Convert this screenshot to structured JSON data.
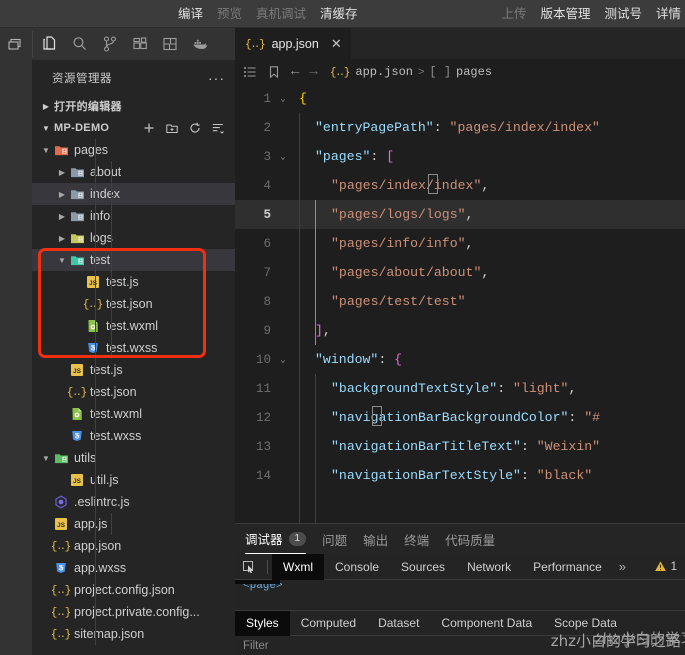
{
  "topbar": {
    "left_items": [
      {
        "label": "编译",
        "dim": false
      },
      {
        "label": "预览",
        "dim": true
      },
      {
        "label": "真机调试",
        "dim": true
      },
      {
        "label": "清缓存",
        "dim": false
      }
    ],
    "right_items": [
      {
        "label": "上传",
        "dim": true
      },
      {
        "label": "版本管理",
        "dim": false
      },
      {
        "label": "测试号",
        "dim": false
      },
      {
        "label": "详情",
        "dim": false
      }
    ]
  },
  "activity_bar": {
    "icons": [
      "layout-panel-icon",
      "files-explorer-icon",
      "search-icon",
      "source-control-icon",
      "extensions-icon",
      "split-layout-icon",
      "docker-icon"
    ]
  },
  "sidebar": {
    "title": "资源管理器",
    "more_actions": "···",
    "open_editors_label": "打开的编辑器",
    "project_label": "MP-DEMO",
    "project_actions": [
      "new-file-icon",
      "new-folder-icon",
      "refresh-icon",
      "collapse-all-icon"
    ],
    "tree": [
      {
        "label": "pages",
        "depth": 1,
        "type": "folder",
        "color": "#e06c4a",
        "open": true,
        "selected": false
      },
      {
        "label": "about",
        "depth": 2,
        "type": "folder",
        "color": "#8a9aa8",
        "open": false,
        "selected": false
      },
      {
        "label": "index",
        "depth": 2,
        "type": "folder",
        "color": "#8a9aa8",
        "open": false,
        "selected": true
      },
      {
        "label": "info",
        "depth": 2,
        "type": "folder",
        "color": "#8a9aa8",
        "open": false,
        "selected": false
      },
      {
        "label": "logs",
        "depth": 2,
        "type": "folder",
        "color": "#c3c95a",
        "open": false,
        "selected": false
      },
      {
        "label": "test",
        "depth": 2,
        "type": "folder",
        "color": "#3fc7a8",
        "open": true,
        "selected": true
      },
      {
        "label": "test.js",
        "depth": 3,
        "type": "js",
        "selected": false
      },
      {
        "label": "test.json",
        "depth": 3,
        "type": "json",
        "selected": false
      },
      {
        "label": "test.wxml",
        "depth": 3,
        "type": "wxml",
        "selected": false
      },
      {
        "label": "test.wxss",
        "depth": 3,
        "type": "wxss",
        "selected": false
      },
      {
        "label": "test.js",
        "depth": 2,
        "type": "js",
        "selected": false
      },
      {
        "label": "test.json",
        "depth": 2,
        "type": "json",
        "selected": false
      },
      {
        "label": "test.wxml",
        "depth": 2,
        "type": "wxml",
        "selected": false
      },
      {
        "label": "test.wxss",
        "depth": 2,
        "type": "wxss",
        "selected": false
      },
      {
        "label": "utils",
        "depth": 1,
        "type": "folder",
        "color": "#5dbb63",
        "open": true,
        "selected": false
      },
      {
        "label": "util.js",
        "depth": 2,
        "type": "js",
        "selected": false
      },
      {
        "label": ".eslintrc.js",
        "depth": 1,
        "type": "eslint",
        "selected": false
      },
      {
        "label": "app.js",
        "depth": 1,
        "type": "js",
        "selected": false
      },
      {
        "label": "app.json",
        "depth": 1,
        "type": "json",
        "selected": false
      },
      {
        "label": "app.wxss",
        "depth": 1,
        "type": "wxss",
        "selected": false
      },
      {
        "label": "project.config.json",
        "depth": 1,
        "type": "json",
        "selected": false
      },
      {
        "label": "project.private.config...",
        "depth": 1,
        "type": "json",
        "selected": false
      },
      {
        "label": "sitemap.json",
        "depth": 1,
        "type": "json",
        "selected": false
      }
    ],
    "annotation_color": "#f03010"
  },
  "editor": {
    "tab": {
      "label": "app.json",
      "icon": "json-icon",
      "close": "✕"
    },
    "breadcrumb": {
      "icons": [
        "outline-list-icon",
        "bookmark-icon",
        "back-arrow-icon",
        "forward-arrow-icon"
      ],
      "back": "←",
      "forward": "→",
      "file": "app.json",
      "separator": ">",
      "node_bracket": "[ ]",
      "node": "pages"
    },
    "active_line": 5,
    "lines": [
      {
        "n": 1,
        "fold": "v",
        "indent": 0,
        "tokens": [
          {
            "t": "{",
            "c": "br"
          }
        ]
      },
      {
        "n": 2,
        "fold": "",
        "indent": 1,
        "tokens": [
          {
            "t": "\"entryPagePath\"",
            "c": "k"
          },
          {
            "t": ": ",
            "c": "p"
          },
          {
            "t": "\"pages/index/index\"",
            "c": "s"
          }
        ]
      },
      {
        "n": 3,
        "fold": "v",
        "indent": 1,
        "tokens": [
          {
            "t": "\"pages\"",
            "c": "k"
          },
          {
            "t": ": ",
            "c": "p"
          },
          {
            "t": "[",
            "c": "brp"
          }
        ]
      },
      {
        "n": 4,
        "fold": "",
        "indent": 2,
        "tokens": [
          {
            "t": "\"pages/index/index\"",
            "c": "s"
          },
          {
            "t": ",",
            "c": "p"
          }
        ]
      },
      {
        "n": 5,
        "fold": "",
        "indent": 2,
        "tokens": [
          {
            "t": "\"pages/logs/logs\"",
            "c": "s"
          },
          {
            "t": ",",
            "c": "p"
          }
        ]
      },
      {
        "n": 6,
        "fold": "",
        "indent": 2,
        "tokens": [
          {
            "t": "\"pages/info/info\"",
            "c": "s"
          },
          {
            "t": ",",
            "c": "p"
          }
        ]
      },
      {
        "n": 7,
        "fold": "",
        "indent": 2,
        "tokens": [
          {
            "t": "\"pages/about/about\"",
            "c": "s"
          },
          {
            "t": ",",
            "c": "p"
          }
        ]
      },
      {
        "n": 8,
        "fold": "",
        "indent": 2,
        "tokens": [
          {
            "t": "\"pages/test/test\"",
            "c": "s"
          }
        ]
      },
      {
        "n": 9,
        "fold": "",
        "indent": 1,
        "tokens": [
          {
            "t": "]",
            "c": "brp"
          },
          {
            "t": ",",
            "c": "p"
          }
        ]
      },
      {
        "n": 10,
        "fold": "v",
        "indent": 1,
        "tokens": [
          {
            "t": "\"window\"",
            "c": "k"
          },
          {
            "t": ": ",
            "c": "p"
          },
          {
            "t": "{",
            "c": "brp"
          }
        ]
      },
      {
        "n": 11,
        "fold": "",
        "indent": 2,
        "tokens": [
          {
            "t": "\"backgroundTextStyle\"",
            "c": "k"
          },
          {
            "t": ": ",
            "c": "p"
          },
          {
            "t": "\"light\"",
            "c": "s"
          },
          {
            "t": ",",
            "c": "p"
          }
        ]
      },
      {
        "n": 12,
        "fold": "",
        "indent": 2,
        "tokens": [
          {
            "t": "\"navigationBarBackgroundColor\"",
            "c": "k"
          },
          {
            "t": ": ",
            "c": "p"
          },
          {
            "t": "\"#",
            "c": "s"
          }
        ]
      },
      {
        "n": 13,
        "fold": "",
        "indent": 2,
        "tokens": [
          {
            "t": "\"navigationBarTitleText\"",
            "c": "k"
          },
          {
            "t": ": ",
            "c": "p"
          },
          {
            "t": "\"Weixin\"",
            "c": "s"
          }
        ]
      },
      {
        "n": 14,
        "fold": "",
        "indent": 2,
        "tokens": [
          {
            "t": "\"navigationBarTextStyle\"",
            "c": "k"
          },
          {
            "t": ": ",
            "c": "p"
          },
          {
            "t": "\"black\"",
            "c": "s"
          }
        ]
      }
    ]
  },
  "panel": {
    "tabs": [
      {
        "label": "调试器",
        "badge": "1",
        "active": true
      },
      {
        "label": "问题",
        "badge": "",
        "active": false
      },
      {
        "label": "输出",
        "badge": "",
        "active": false
      },
      {
        "label": "终端",
        "badge": "",
        "active": false
      },
      {
        "label": "代码质量",
        "badge": "",
        "active": false
      }
    ],
    "devtools": {
      "inspect_icon": "inspect-element-icon",
      "tabs": [
        {
          "label": "Wxml",
          "active": true
        },
        {
          "label": "Console",
          "active": false
        },
        {
          "label": "Sources",
          "active": false
        },
        {
          "label": "Network",
          "active": false
        },
        {
          "label": "Performance",
          "active": false
        }
      ],
      "more": "»",
      "warning_icon": "warning-triangle-icon",
      "warning_count": "1",
      "dom_snippet": "<page>",
      "sub_tabs": [
        {
          "label": "Styles",
          "active": true
        },
        {
          "label": "Computed",
          "active": false
        },
        {
          "label": "Dataset",
          "active": false
        },
        {
          "label": "Component Data",
          "active": false
        },
        {
          "label": "Scope Data",
          "active": false
        }
      ],
      "filter_placeholder": "Filter"
    }
  },
  "watermark": "zhz小白的学习之路"
}
